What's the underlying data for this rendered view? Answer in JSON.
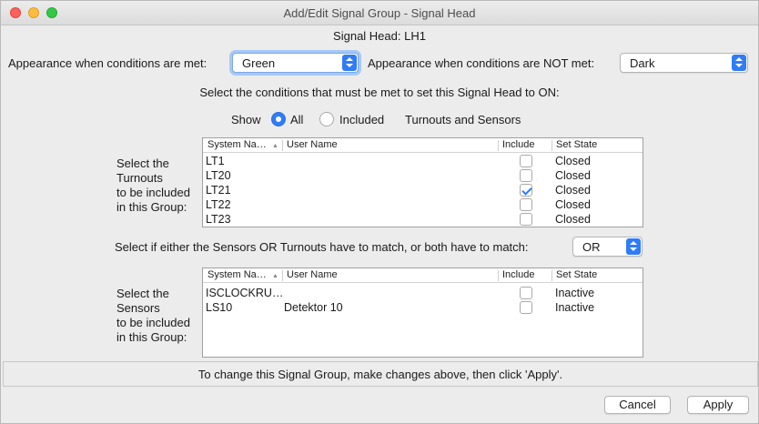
{
  "window": {
    "title": "Add/Edit Signal Group - Signal Head"
  },
  "header": {
    "signal_head": "Signal Head: LH1"
  },
  "appearance": {
    "met_label": "Appearance when conditions are met:",
    "met_value": "Green",
    "not_met_label": "Appearance when conditions are NOT met:",
    "not_met_value": "Dark"
  },
  "conditions": {
    "instruction": "Select the conditions that must be met to set this Signal Head to ON:"
  },
  "show": {
    "label": "Show",
    "all_label": "All",
    "included_label": "Included",
    "suffix": "Turnouts and Sensors",
    "selected": "All"
  },
  "turnouts": {
    "caption": [
      "Select the",
      "Turnouts",
      "to be included",
      "in this Group:"
    ],
    "columns": [
      "System Na…",
      "User Name",
      "Include",
      "Set State"
    ],
    "rows": [
      {
        "system": "LT1",
        "user": "",
        "include": false,
        "state": "Closed"
      },
      {
        "system": "LT20",
        "user": "",
        "include": false,
        "state": "Closed"
      },
      {
        "system": "LT21",
        "user": "",
        "include": true,
        "state": "Closed"
      },
      {
        "system": "LT22",
        "user": "",
        "include": false,
        "state": "Closed"
      },
      {
        "system": "LT23",
        "user": "",
        "include": false,
        "state": "Closed"
      }
    ]
  },
  "match": {
    "label": "Select if either the Sensors OR Turnouts have to match, or both have to match:",
    "value": "OR"
  },
  "sensors": {
    "caption": [
      "Select the",
      "Sensors",
      "to be included",
      "in this Group:"
    ],
    "columns": [
      "System Na…",
      "User Name",
      "Include",
      "Set State"
    ],
    "rows": [
      {
        "system": "ISCLOCKRU…",
        "user": "",
        "include": false,
        "state": "Inactive"
      },
      {
        "system": "LS10",
        "user": "Detektor 10",
        "include": false,
        "state": "Inactive"
      }
    ]
  },
  "footer": {
    "info": "To change this Signal Group, make changes above, then click 'Apply'.",
    "cancel_label": "Cancel",
    "apply_label": "Apply"
  },
  "colors": {
    "accent": "#2f7cf6"
  }
}
